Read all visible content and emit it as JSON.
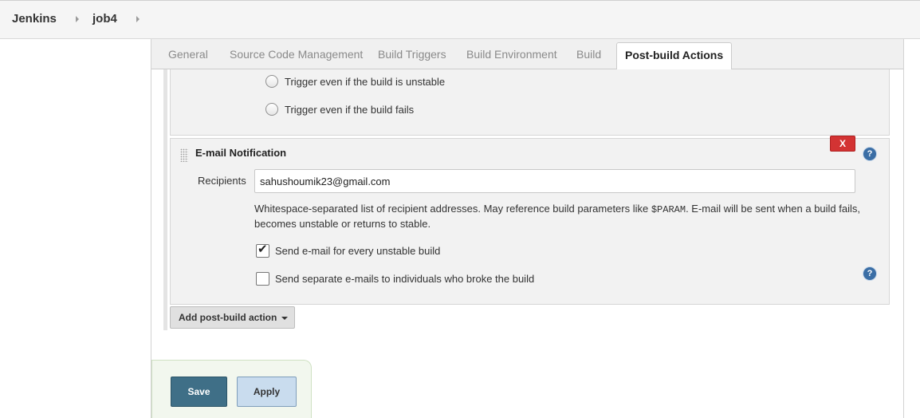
{
  "breadcrumb": {
    "items": [
      "Jenkins",
      "job4"
    ]
  },
  "tabs": [
    {
      "label": "General",
      "active": false
    },
    {
      "label": "Source Code Management",
      "active": false
    },
    {
      "label": "Build Triggers",
      "active": false
    },
    {
      "label": "Build Environment",
      "active": false
    },
    {
      "label": "Build",
      "active": false
    },
    {
      "label": "Post-build Actions",
      "active": true
    }
  ],
  "trigger_options": {
    "unstable_label": "Trigger even if the build is unstable",
    "fails_label": "Trigger even if the build fails",
    "unstable_selected": false,
    "fails_selected": false
  },
  "email": {
    "title": "E-mail Notification",
    "close_label": "X",
    "recipients_label": "Recipients",
    "recipients_value": "sahushoumik23@gmail.com",
    "desc_before": "Whitespace-separated list of recipient addresses. May reference build parameters like ",
    "desc_code": "$PARAM",
    "desc_after": ". E-mail will be sent when a build fails, becomes unstable or returns to stable.",
    "opt_unstable_label": "Send e-mail for every unstable build",
    "opt_unstable_checked": true,
    "opt_separate_label": "Send separate e-mails to individuals who broke the build",
    "opt_separate_checked": false,
    "help_glyph": "?"
  },
  "add_action": {
    "label": "Add post-build action"
  },
  "form_buttons": {
    "save_label": "Save",
    "apply_label": "Apply"
  },
  "colors": {
    "save_bg": "#3f6f87",
    "apply_bg": "#c9dcee",
    "delete_bg": "#d33333",
    "help_bg": "#3b6ea5"
  },
  "icons": {
    "breadcrumb_separator": "caret-right-icon",
    "drag_handle": "drag-handle-icon",
    "help": "help-icon",
    "dropdown": "caret-down-icon",
    "checked": "checkmark-icon"
  }
}
